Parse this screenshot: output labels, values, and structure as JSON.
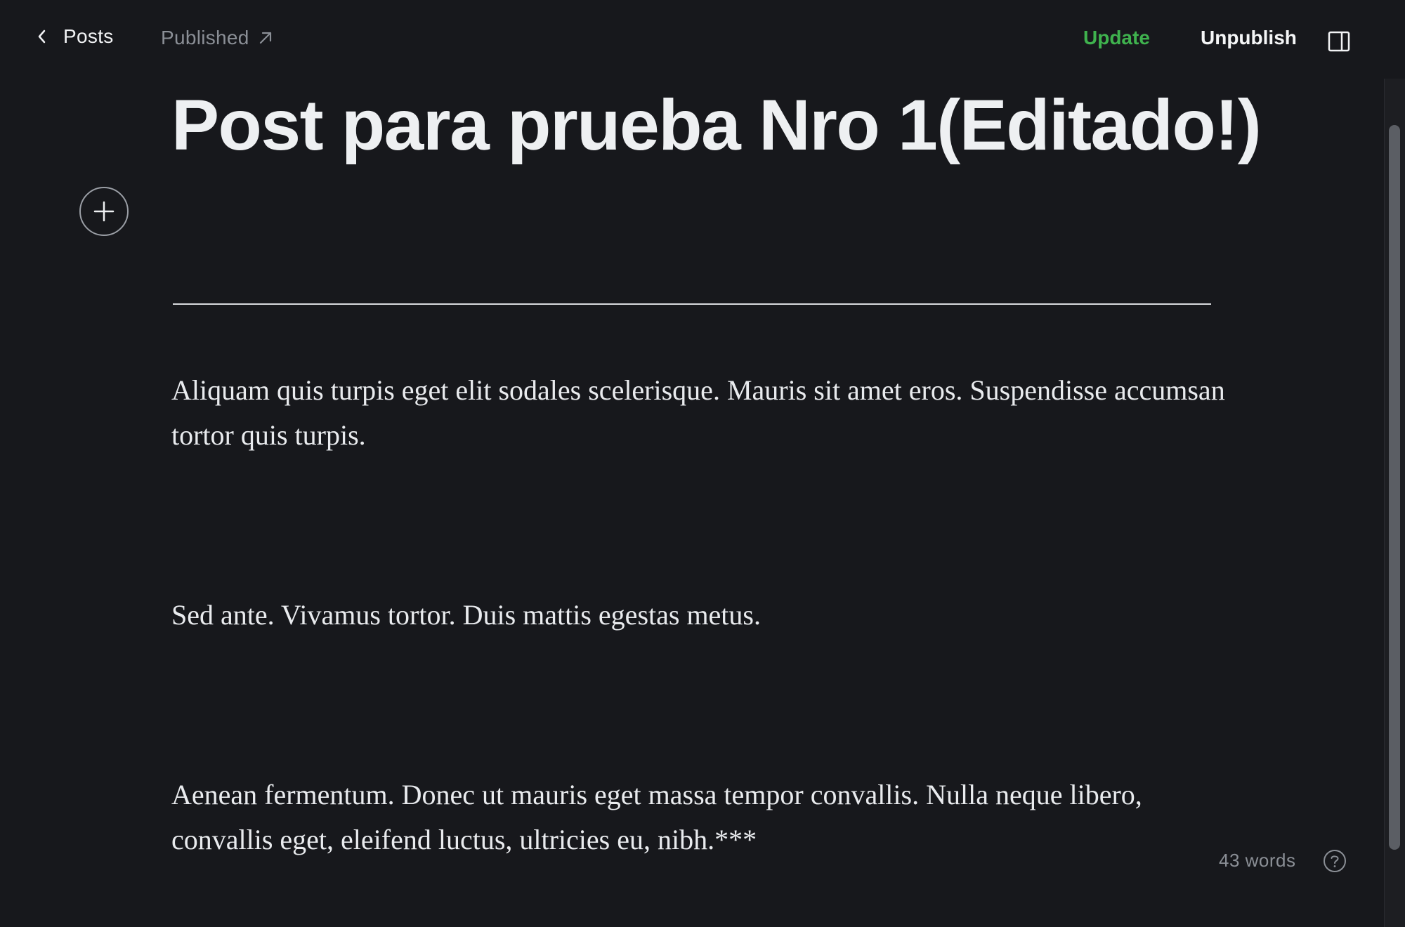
{
  "header": {
    "back_label": "Posts",
    "status_label": "Published",
    "update_label": "Update",
    "unpublish_label": "Unpublish"
  },
  "editor": {
    "title": "Post para prueba Nro 1(Editado!)",
    "paragraphs": [
      "Aliquam quis turpis eget elit sodales scelerisque. Mauris sit amet eros. Suspendisse accumsan tortor quis turpis.",
      "Sed ante. Vivamus tortor. Duis mattis egestas metus.",
      "Aenean fermentum. Donec ut mauris eget massa tempor convallis. Nulla neque libero, convallis eget, eleifend luctus, ultricies eu, nibh.***"
    ]
  },
  "footer": {
    "word_count": "43 words"
  },
  "colors": {
    "background": "#17181c",
    "accent_update": "#3fb24e",
    "text": "#e9ebee",
    "muted": "#8b8f96"
  },
  "icons": {
    "back": "chevron-left-icon",
    "external": "arrow-up-right-icon",
    "sidebar": "sidebar-toggle-icon",
    "add": "plus-icon",
    "help": "question-mark-icon"
  }
}
